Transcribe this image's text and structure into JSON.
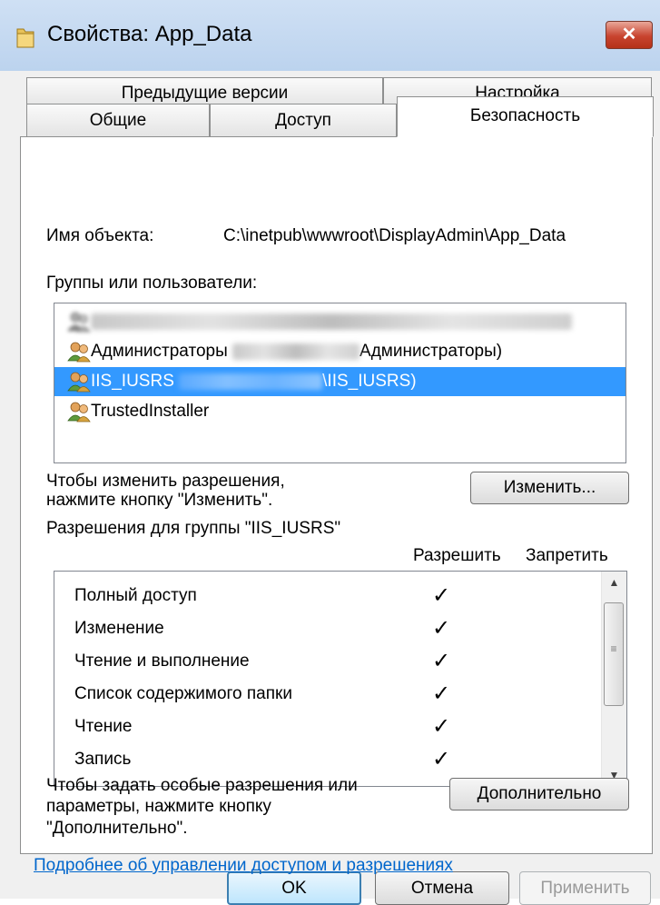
{
  "window": {
    "title": "Свойства: App_Data",
    "close_label": "✕"
  },
  "tabs": {
    "previous_versions": "Предыдущие версии",
    "customize": "Настройка",
    "general": "Общие",
    "sharing": "Доступ",
    "security": "Безопасность"
  },
  "security": {
    "object_name_label": "Имя объекта:",
    "object_name_value": "C:\\inetpub\\wwwroot\\DisplayAdmin\\App_Data",
    "groups_label": "Группы или пользователи:",
    "users": [
      {
        "prefix": "",
        "suffix": "",
        "selected": false,
        "blurred": true
      },
      {
        "prefix": "Администраторы ",
        "suffix": "Администраторы)",
        "selected": false,
        "blurred": false
      },
      {
        "prefix": "IIS_IUSRS ",
        "suffix": "\\IIS_IUSRS)",
        "selected": true,
        "blurred": false
      },
      {
        "prefix": "TrustedInstaller",
        "suffix": "",
        "selected": false,
        "blurred": false
      }
    ],
    "change_hint_line1": "Чтобы изменить разрешения,",
    "change_hint_line2": "нажмите кнопку \"Изменить\".",
    "change_button": "Изменить...",
    "permissions_label": "Разрешения для группы \"IIS_IUSRS\"",
    "allow_header": "Разрешить",
    "deny_header": "Запретить",
    "permissions": [
      {
        "name": "Полный доступ",
        "allow": "✓",
        "deny": ""
      },
      {
        "name": "Изменение",
        "allow": "✓",
        "deny": ""
      },
      {
        "name": "Чтение и выполнение",
        "allow": "✓",
        "deny": ""
      },
      {
        "name": "Список содержимого папки",
        "allow": "✓",
        "deny": ""
      },
      {
        "name": "Чтение",
        "allow": "✓",
        "deny": ""
      },
      {
        "name": "Запись",
        "allow": "✓",
        "deny": ""
      }
    ],
    "advanced_hint_line1": "Чтобы задать особые разрешения или",
    "advanced_hint_line2": "параметры, нажмите кнопку",
    "advanced_hint_line3": "\"Дополнительно\".",
    "advanced_button": "Дополнительно",
    "help_link": "Подробнее об управлении доступом и разрешениях"
  },
  "footer": {
    "ok": "OK",
    "cancel": "Отмена",
    "apply": "Применить"
  },
  "icons": {
    "folder": "folder-icon",
    "users": "users-group-icon",
    "scroll_up": "▲",
    "scroll_down": "▼",
    "grip": "≡"
  }
}
